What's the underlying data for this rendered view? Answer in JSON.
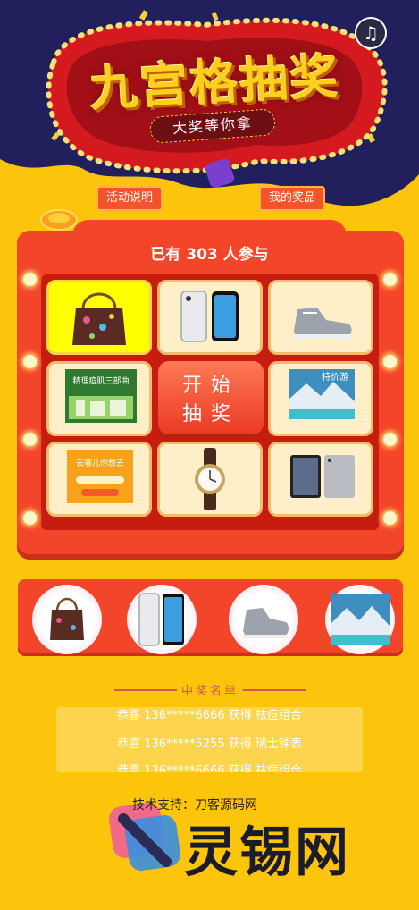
{
  "header": {
    "title": "九宫格抽奖",
    "subtitle": "大奖等你拿",
    "music_icon": "music-note-icon"
  },
  "actions": {
    "rules_label": "活动说明",
    "my_prizes_label": "我的奖品"
  },
  "lottery": {
    "participants_text": "已有 303 人参与",
    "start_label": "开始抽奖",
    "prizes": [
      {
        "name": "handbag",
        "icon": "handbag-icon"
      },
      {
        "name": "iphone",
        "icon": "phone-icon"
      },
      {
        "name": "sneaker",
        "icon": "sneaker-icon"
      },
      {
        "name": "skincare-set",
        "icon": "skincare-box-icon",
        "label": "精理痘肌三部曲"
      },
      {
        "name": "travel",
        "icon": "travel-card-icon",
        "label": "特价游"
      },
      {
        "name": "gift-card",
        "icon": "gift-card-icon",
        "label": "去哪儿你想去"
      },
      {
        "name": "watch",
        "icon": "watch-icon"
      },
      {
        "name": "ipad",
        "icon": "tablet-icon"
      }
    ],
    "active_index": 0,
    "colors": {
      "board": "#f3452a",
      "active": "#ffff00",
      "cell": "#ffefc8"
    }
  },
  "winners": {
    "title": "中奖名单",
    "rows": [
      "恭喜 136*****6666 获得 祛痘组合",
      "恭喜 136*****5255 获得 瑞士钟表",
      "恭喜 136*****6666 获得 祛痘组合"
    ]
  },
  "footer": {
    "support": "技术支持：刀客源码网",
    "watermark": "灵锡网"
  }
}
